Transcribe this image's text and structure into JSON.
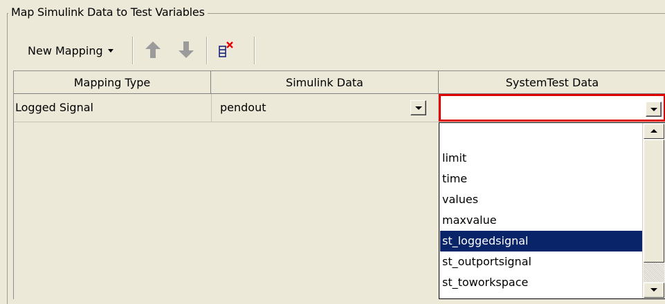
{
  "group": {
    "title": "Map Simulink Data to Test Variables"
  },
  "toolbar": {
    "new_mapping_label": "New Mapping",
    "icons": [
      "move-up-icon",
      "move-down-icon",
      "delete-mapping-icon"
    ]
  },
  "table": {
    "columns": [
      "Mapping Type",
      "Simulink Data",
      "SystemTest Data"
    ],
    "rows": [
      {
        "mapping_type": "Logged Signal",
        "simulink_data": "pendout",
        "systemtest_data": ""
      }
    ]
  },
  "dropdown": {
    "options": [
      "",
      "limit",
      "time",
      "values",
      "maxvalue",
      "st_loggedsignal",
      "st_outportsignal",
      "st_toworkspace"
    ],
    "selected": "st_loggedsignal"
  },
  "colors": {
    "selection": "#0a246a",
    "editor_border": "#e00000",
    "background": "#ece9d8"
  }
}
